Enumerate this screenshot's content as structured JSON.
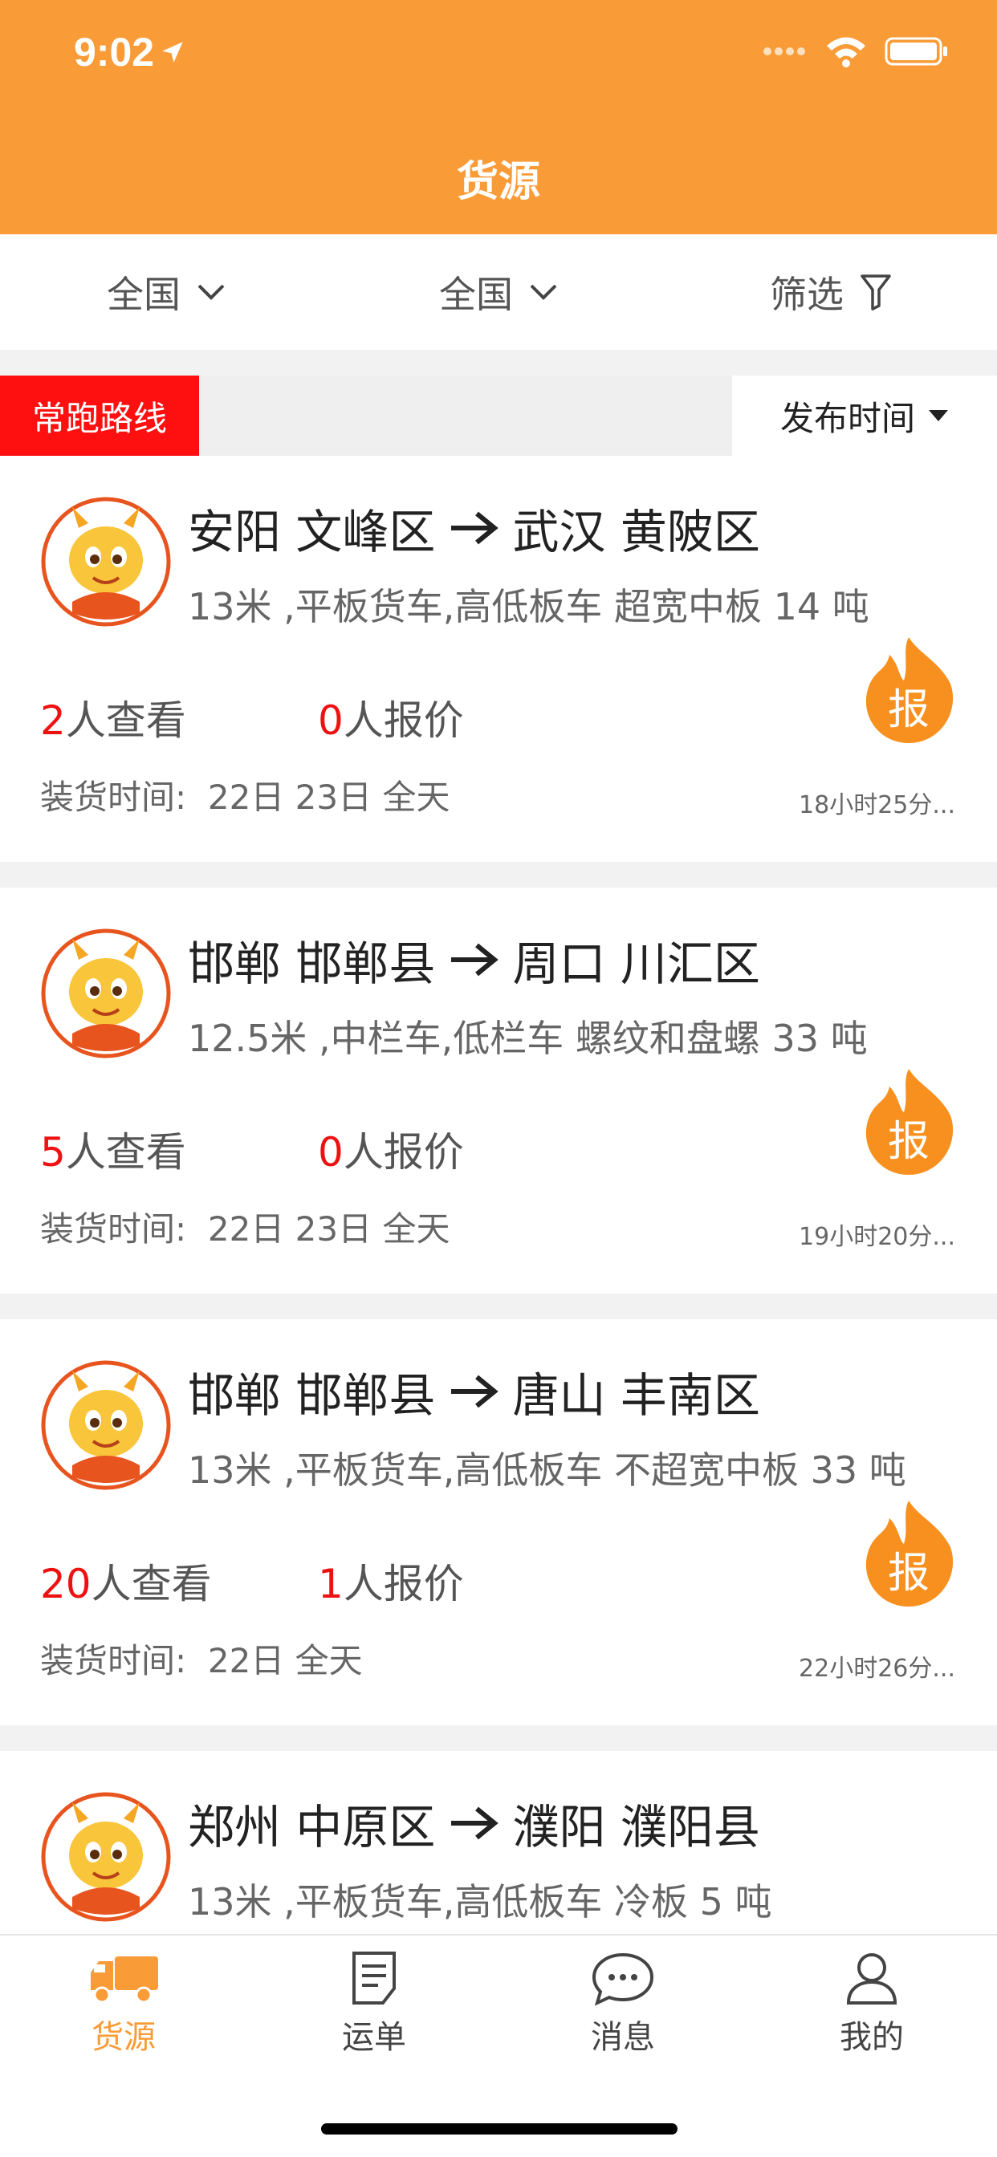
{
  "status_bar": {
    "time": "9:02"
  },
  "header": {
    "title": "货源"
  },
  "filters": [
    {
      "label": "全国",
      "icon": "chevron-down-icon"
    },
    {
      "label": "全国",
      "icon": "chevron-down-icon"
    },
    {
      "label": "筛选",
      "icon": "filter-icon"
    }
  ],
  "sort_bar": {
    "route_tag": "常跑路线",
    "sort_label": "发布时间"
  },
  "colors": {
    "brand": "#F99B37",
    "tag_red": "#FF1010",
    "count_red": "#EE1111"
  },
  "cards": [
    {
      "from": "安阳 文峰区",
      "to": "武汉 黄陂区",
      "spec": "13米 ,平板货车,高低板车 超宽中板 14 吨",
      "views": "2",
      "views_suffix": "人查看",
      "quotes": "0",
      "quotes_suffix": "人报价",
      "load_label": "装货时间:",
      "load_value": "22日 23日 全天",
      "posted": "18小时25分...",
      "badge": "报"
    },
    {
      "from": "邯郸 邯郸县",
      "to": "周口 川汇区",
      "spec": "12.5米 ,中栏车,低栏车 螺纹和盘螺 33 吨",
      "views": "5",
      "views_suffix": "人查看",
      "quotes": "0",
      "quotes_suffix": "人报价",
      "load_label": "装货时间:",
      "load_value": "22日 23日 全天",
      "posted": "19小时20分...",
      "badge": "报"
    },
    {
      "from": "邯郸 邯郸县",
      "to": "唐山 丰南区",
      "spec": "13米 ,平板货车,高低板车 不超宽中板 33 吨",
      "views": "20",
      "views_suffix": "人查看",
      "quotes": "1",
      "quotes_suffix": "人报价",
      "load_label": "装货时间:",
      "load_value": "22日 全天",
      "posted": "22小时26分...",
      "badge": "报"
    },
    {
      "from": "郑州 中原区",
      "to": "濮阳 濮阳县",
      "spec": "13米 ,平板货车,高低板车 冷板 5 吨"
    }
  ],
  "tabs": [
    {
      "label": "货源",
      "icon": "truck-icon",
      "active": true
    },
    {
      "label": "运单",
      "icon": "document-icon",
      "active": false
    },
    {
      "label": "消息",
      "icon": "chat-bubble-icon",
      "active": false
    },
    {
      "label": "我的",
      "icon": "person-icon",
      "active": false
    }
  ]
}
